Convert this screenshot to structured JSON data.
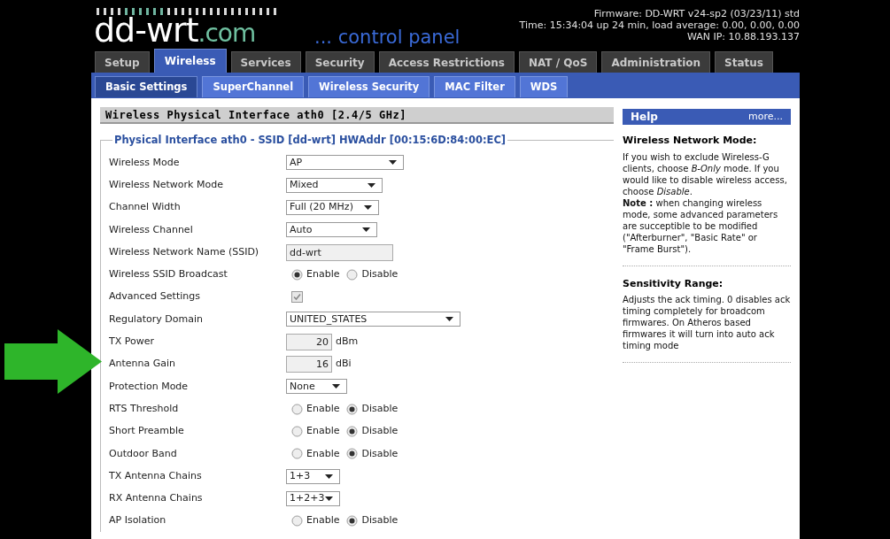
{
  "header": {
    "logo": {
      "name": "dd-wrt",
      "domain": ".com"
    },
    "tagline": "... control panel",
    "status_lines": [
      "Firmware: DD-WRT v24-sp2 (03/23/11) std",
      "Time: 15:34:04 up 24 min, load average: 0.00, 0.00, 0.00",
      "WAN IP: 10.88.193.137"
    ]
  },
  "tabs": [
    {
      "label": "Setup",
      "selected": false
    },
    {
      "label": "Wireless",
      "selected": true
    },
    {
      "label": "Services",
      "selected": false
    },
    {
      "label": "Security",
      "selected": false
    },
    {
      "label": "Access Restrictions",
      "selected": false
    },
    {
      "label": "NAT / QoS",
      "selected": false
    },
    {
      "label": "Administration",
      "selected": false
    },
    {
      "label": "Status",
      "selected": false
    }
  ],
  "subtabs": [
    {
      "label": "Basic Settings",
      "selected": true
    },
    {
      "label": "SuperChannel",
      "selected": false
    },
    {
      "label": "Wireless Security",
      "selected": false
    },
    {
      "label": "MAC Filter",
      "selected": false
    },
    {
      "label": "WDS",
      "selected": false
    }
  ],
  "section_title": "Wireless Physical Interface ath0 [2.4/5 GHz]",
  "fieldset_legend": "Physical Interface ath0 - SSID [dd-wrt] HWAddr [00:15:6D:84:00:EC]",
  "fields": [
    {
      "kind": "select",
      "label": "Wireless Mode",
      "value": "AP"
    },
    {
      "kind": "select",
      "label": "Wireless Network Mode",
      "value": "Mixed"
    },
    {
      "kind": "select",
      "label": "Channel Width",
      "value": "Full (20 MHz)"
    },
    {
      "kind": "select",
      "label": "Wireless Channel",
      "value": "Auto"
    },
    {
      "kind": "text",
      "label": "Wireless Network Name (SSID)",
      "value": "dd-wrt"
    },
    {
      "kind": "radio",
      "label": "Wireless SSID Broadcast",
      "options": [
        {
          "label": "Enable",
          "selected": true
        },
        {
          "label": "Disable",
          "selected": false
        }
      ]
    },
    {
      "kind": "checkbox",
      "label": "Advanced Settings",
      "checked": true,
      "disabled": true
    },
    {
      "kind": "select",
      "label": "Regulatory Domain",
      "value": "UNITED_STATES"
    },
    {
      "kind": "number",
      "label": "TX Power",
      "value": "20",
      "unit": "dBm"
    },
    {
      "kind": "number",
      "label": "Antenna Gain",
      "value": "16",
      "unit": "dBi"
    },
    {
      "kind": "select",
      "label": "Protection Mode",
      "value": "None"
    },
    {
      "kind": "radio",
      "label": "RTS Threshold",
      "options": [
        {
          "label": "Enable",
          "selected": false
        },
        {
          "label": "Disable",
          "selected": true
        }
      ]
    },
    {
      "kind": "radio",
      "label": "Short Preamble",
      "options": [
        {
          "label": "Enable",
          "selected": false
        },
        {
          "label": "Disable",
          "selected": true
        }
      ]
    },
    {
      "kind": "radio",
      "label": "Outdoor Band",
      "options": [
        {
          "label": "Enable",
          "selected": false
        },
        {
          "label": "Disable",
          "selected": true
        }
      ]
    },
    {
      "kind": "select",
      "label": "TX Antenna Chains",
      "value": "1+3"
    },
    {
      "kind": "select",
      "label": "RX Antenna Chains",
      "value": "1+2+3"
    },
    {
      "kind": "radio",
      "label": "AP Isolation",
      "options": [
        {
          "label": "Enable",
          "selected": false
        },
        {
          "label": "Disable",
          "selected": true
        }
      ]
    }
  ],
  "help": {
    "title": "Help",
    "more": "more...",
    "sections": [
      {
        "heading": "Wireless Network Mode:",
        "text": "If you wish to exclude Wireless-G clients, choose *B-Only* mode. If you would like to disable wireless access, choose *Disable*.\n**Note :** when changing wireless mode, some advanced parameters are succeptible to be modified (\"Afterburner\", \"Basic Rate\" or \"Frame Burst\")."
      },
      {
        "heading": "Sensitivity Range:",
        "text": "Adjusts the ack timing. 0 disables ack timing completely for broadcom firmwares. On Atheros based firmwares it will turn into auto ack timing mode"
      }
    ]
  }
}
